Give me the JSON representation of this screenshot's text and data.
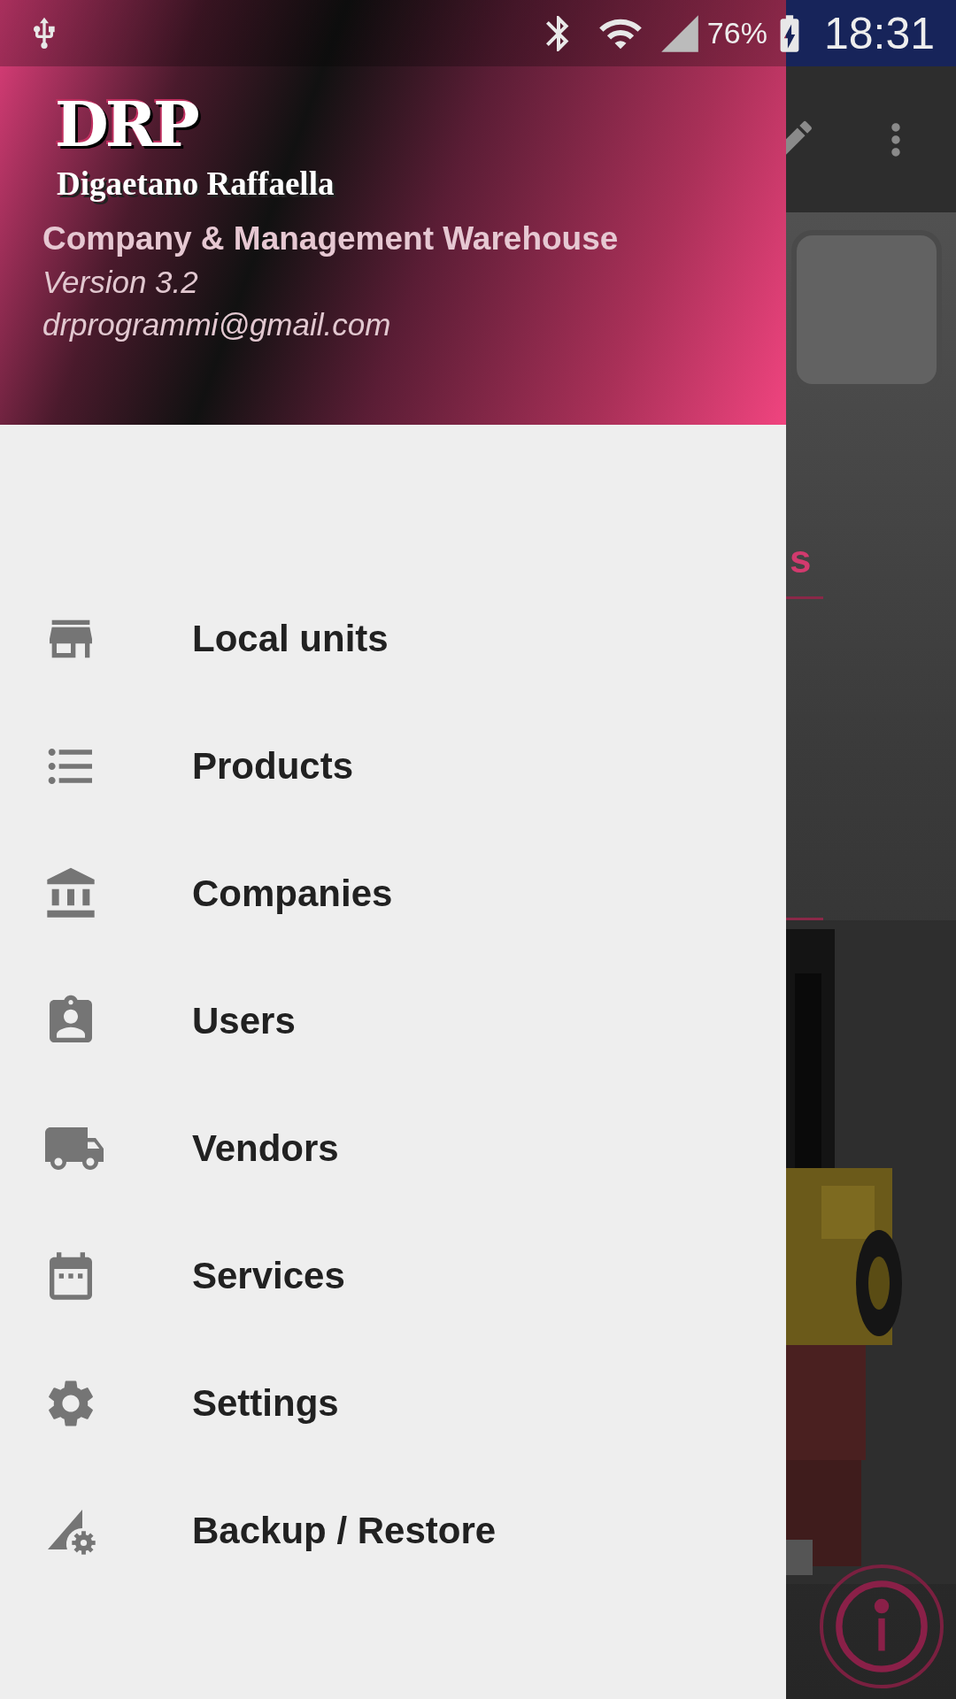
{
  "status_bar": {
    "battery": "76%",
    "time": "18:31"
  },
  "header": {
    "logo_mark": "DRP",
    "logo_name": "Digaetano Raffaella",
    "title": "Company & Management Warehouse",
    "version": "Version 3.2",
    "email": "drprogrammi@gmail.com"
  },
  "menu": [
    {
      "label": "Local units",
      "kind": "store"
    },
    {
      "label": "Products",
      "kind": "list"
    },
    {
      "label": "Companies",
      "kind": "bank"
    },
    {
      "label": "Users",
      "kind": "badge"
    },
    {
      "label": "Vendors",
      "kind": "truck"
    },
    {
      "label": "Services",
      "kind": "calendar"
    },
    {
      "label": "Settings",
      "kind": "settings"
    },
    {
      "label": "Backup / Restore",
      "kind": "signal"
    }
  ],
  "background_screen": {
    "heading_fragment": "s"
  }
}
